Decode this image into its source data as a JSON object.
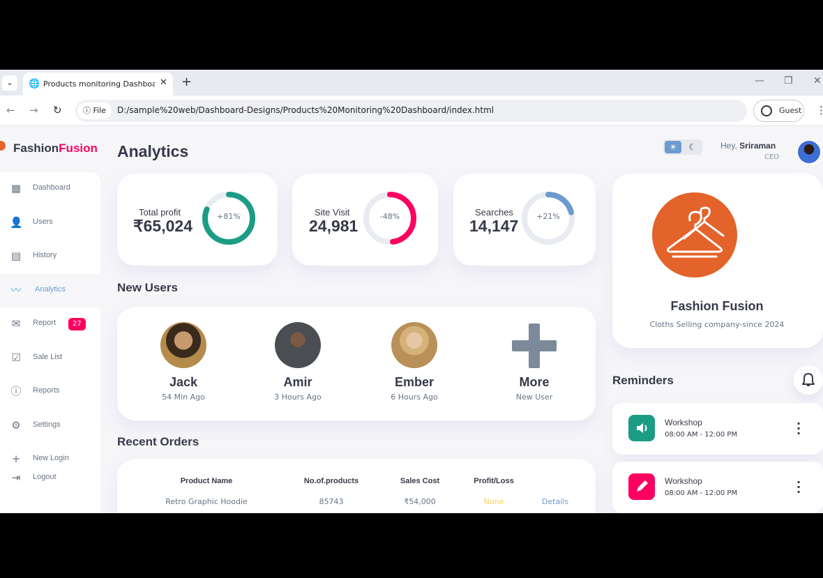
{
  "browser": {
    "tab_title": "Products monitoring Dashboard",
    "file_label": "File",
    "url": "D:/sample%20web/Dashboard-Designs/Products%20Monitoring%20Dashboard/index.html",
    "profile_label": "Guest"
  },
  "brand": {
    "name_part1": "Fashion",
    "name_part2": "Fusion"
  },
  "sidebar": {
    "items": [
      {
        "label": "Dashboard",
        "icon": "dashboard-icon"
      },
      {
        "label": "Users",
        "icon": "person-icon"
      },
      {
        "label": "History",
        "icon": "receipt-icon"
      },
      {
        "label": "Analytics",
        "icon": "insights-icon",
        "active": true
      },
      {
        "label": "Report",
        "icon": "mail-icon",
        "badge": "27"
      },
      {
        "label": "Sale List",
        "icon": "inventory-icon"
      },
      {
        "label": "Reports",
        "icon": "report-icon"
      },
      {
        "label": "Settings",
        "icon": "gear-icon"
      },
      {
        "label": "New Login",
        "icon": "plus-icon"
      },
      {
        "label": "Logout",
        "icon": "logout-icon"
      }
    ]
  },
  "header": {
    "title": "Analytics",
    "greeting": "Hey,",
    "user_name": "Sriraman",
    "role": "CEO"
  },
  "stats": [
    {
      "label": "Total profit",
      "value": "₹65,024",
      "percent_label": "+81%",
      "percent": 81,
      "color": "#1b9c85"
    },
    {
      "label": "Site Visit",
      "value": "24,981",
      "percent_label": "-48%",
      "percent": 48,
      "color": "#ff0060"
    },
    {
      "label": "Searches",
      "value": "14,147",
      "percent_label": "+21%",
      "percent": 21,
      "color": "#6c9bcf"
    }
  ],
  "new_users": {
    "title": "New Users",
    "users": [
      {
        "name": "Jack",
        "time": "54 Min Ago"
      },
      {
        "name": "Amir",
        "time": "3 Hours Ago"
      },
      {
        "name": "Ember",
        "time": "6 Hours Ago"
      },
      {
        "name": "More",
        "time": "New User"
      }
    ]
  },
  "recent_orders": {
    "title": "Recent Orders",
    "headers": [
      "Product Name",
      "No.of.products",
      "Sales Cost",
      "Profit/Loss"
    ],
    "rows": [
      {
        "product": "Retro Graphic Hoodie",
        "count": "85743",
        "cost": "₹54,000",
        "status": "None",
        "action": "Details"
      }
    ]
  },
  "company_card": {
    "name": "Fashion Fusion",
    "tagline": "Cloths Selling company-since 2024"
  },
  "reminders": {
    "title": "Reminders",
    "items": [
      {
        "title": "Workshop",
        "time": "08:00 AM - 12:00 PM",
        "icon": "volume-icon",
        "color": "#1b9c85"
      },
      {
        "title": "Workshop",
        "time": "08:00 AM - 12:00 PM",
        "icon": "edit-icon",
        "color": "#ff0060"
      }
    ]
  },
  "colors": {
    "primary": "#6c9bcf",
    "danger": "#ff0060",
    "success": "#1b9c85",
    "warning": "#f7d060",
    "dark": "#363949",
    "brand_orange": "#e3632a"
  }
}
